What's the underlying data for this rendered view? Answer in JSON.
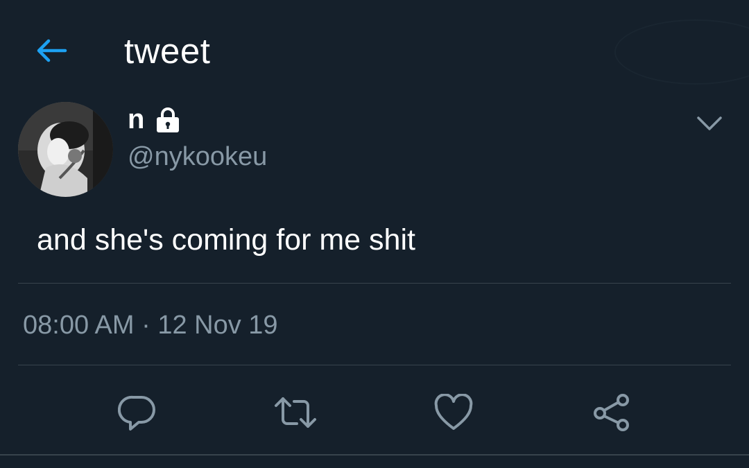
{
  "header": {
    "title": "tweet",
    "back_icon": "arrow-left-icon"
  },
  "colors": {
    "background": "#15202b",
    "accent": "#1da1f2",
    "secondary_text": "#8899a6",
    "divider": "#38444d"
  },
  "tweet": {
    "author_name": "n",
    "author_protected_icon": "lock-icon",
    "author_handle": "@nykookeu",
    "text": "and she's coming for me shit",
    "time": "08:00 AM",
    "separator": "·",
    "date": "12 Nov 19",
    "menu_icon": "chevron-down-icon"
  },
  "actions": [
    {
      "name": "reply",
      "icon": "reply-icon"
    },
    {
      "name": "retweet",
      "icon": "retweet-icon"
    },
    {
      "name": "like",
      "icon": "heart-icon"
    },
    {
      "name": "share",
      "icon": "share-icon"
    }
  ]
}
